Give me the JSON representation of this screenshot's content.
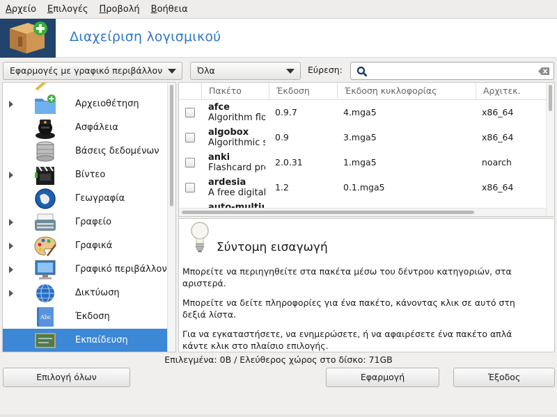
{
  "menubar": {
    "items": [
      {
        "label": "Αρχείο"
      },
      {
        "label": "Επιλογές"
      },
      {
        "label": "Προβολή"
      },
      {
        "label": "Βοήθεια"
      }
    ]
  },
  "banner": {
    "title": "Διαχείριση λογισμικού",
    "icon": "software-package-icon"
  },
  "filters": {
    "type_filter": "Εφαρμογές με γραφικό περιβάλλον",
    "status_filter": "Όλα",
    "find_label": "Εύρεση:",
    "search_value": ""
  },
  "categories": [
    {
      "label": "Αρχειοθέτηση",
      "icon": "archive-folder-icon",
      "expandable": true
    },
    {
      "label": "Ασφάλεια",
      "icon": "security-agent-icon",
      "expandable": false
    },
    {
      "label": "Βάσεις δεδομένων",
      "icon": "database-icon",
      "expandable": false
    },
    {
      "label": "Βίντεο",
      "icon": "video-clapper-icon",
      "expandable": true
    },
    {
      "label": "Γεωγραφία",
      "icon": "globe-icon",
      "expandable": false
    },
    {
      "label": "Γραφείο",
      "icon": "typewriter-icon",
      "expandable": true
    },
    {
      "label": "Γραφικά",
      "icon": "palette-icon",
      "expandable": true
    },
    {
      "label": "Γραφικό περιβάλλον",
      "icon": "desktop-monitor-icon",
      "expandable": true
    },
    {
      "label": "Δικτύωση",
      "icon": "network-globe-icon",
      "expandable": true
    },
    {
      "label": "Έκδοση",
      "icon": "book-icon",
      "expandable": false
    },
    {
      "label": "Εκπαίδευση",
      "icon": "chalkboard-icon",
      "expandable": false
    }
  ],
  "package_table": {
    "columns": [
      "Πακέτο",
      "Έκδοση",
      "Έκδοση κυκλοφορίας",
      "Αρχιτεκ."
    ],
    "rows": [
      {
        "name": "afce",
        "summary": "Algorithm flowchart editor",
        "version": "0.9.7",
        "release": "4.mga5",
        "arch": "x86_64"
      },
      {
        "name": "algobox",
        "summary": "Algorithmic software",
        "version": "0.9",
        "release": "3.mga5",
        "arch": "x86_64"
      },
      {
        "name": "anki",
        "summary": "Flashcard program",
        "version": "2.0.31",
        "release": "1.mga5",
        "arch": "noarch"
      },
      {
        "name": "ardesia",
        "summary": "A free digital sketchpad",
        "version": "1.2",
        "release": "0.1.mga5",
        "arch": "x86_64"
      },
      {
        "name": "auto-multiple-choice",
        "summary": "",
        "version": "",
        "release": "",
        "arch": ""
      }
    ]
  },
  "description": {
    "title": "Σύντομη εισαγωγή",
    "paragraphs": [
      "Μπορείτε να περιηγηθείτε στα πακέτα μέσω του δέντρου κατηγοριών, στα αριστερά.",
      "Μπορείτε να δείτε πληροφορίες για ένα πακέτο, κάνοντας κλικ σε αυτό στη δεξιά λίστα.",
      "Για να εγκαταστήσετε, να ενημερώσετε, ή να αφαιρέσετε ένα πακέτο απλά κάντε κλικ στο πλαίσιο επιλογής."
    ]
  },
  "status": {
    "text": "Επιλεγμένα: 0B / Ελεύθερος χώρος στο δίσκο: 71GB"
  },
  "buttons": {
    "select_all": "Επιλογή όλων",
    "apply": "Εφαρμογή",
    "quit": "Έξοδος"
  },
  "colors": {
    "accent": "#3c87d6",
    "title": "#2f77c5",
    "banner_icon_bg": "#20446b"
  }
}
